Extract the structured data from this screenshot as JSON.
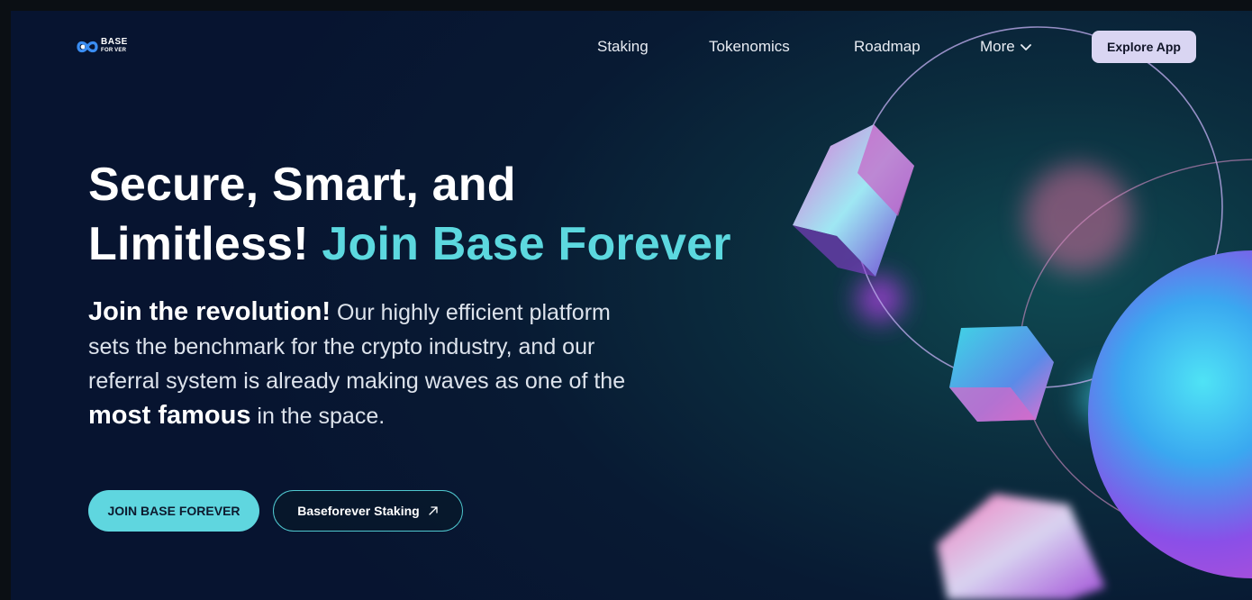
{
  "brand": {
    "logo_line1": "BASE",
    "logo_line2": "FOR VER",
    "logo_icon": "infinity-logo-icon"
  },
  "nav": {
    "items": [
      {
        "label": "Staking"
      },
      {
        "label": "Tokenomics"
      },
      {
        "label": "Roadmap"
      },
      {
        "label": "More",
        "icon": "chevron-down-icon"
      }
    ],
    "cta_label": "Explore App"
  },
  "hero": {
    "title_part1": "Secure, Smart, and",
    "title_part2": "Limitless!",
    "title_accent": "Join Base Forever",
    "desc_lead": "Join the revolution!",
    "desc_part1": " Our highly efficient platform sets the benchmark for the crypto industry, and our referral system is already making waves as one of the ",
    "desc_bold": "most famous",
    "desc_part2": " in the space.",
    "primary_button": "JOIN BASE FOREVER",
    "secondary_button": "Baseforever Staking",
    "secondary_icon": "arrow-up-right-icon"
  },
  "colors": {
    "accent": "#5cd8df",
    "cta_bg": "#d9d5f2",
    "background": "#081a33"
  }
}
